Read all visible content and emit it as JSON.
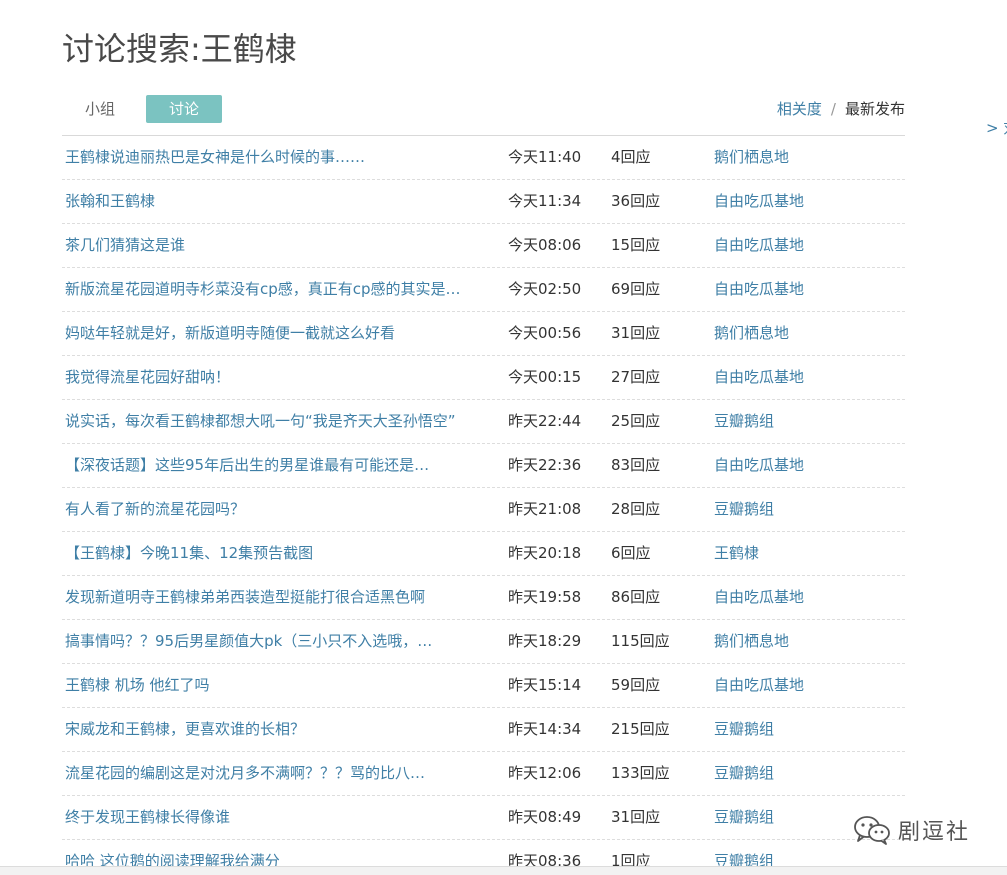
{
  "page": {
    "title": "讨论搜索:王鹤棣"
  },
  "tabs": {
    "group": "小组",
    "discussion": "讨论"
  },
  "sort": {
    "relevance": "相关度",
    "separator": "/",
    "latest": "最新发布"
  },
  "side_link": "> 刘",
  "topics": [
    {
      "title": "王鹤棣说迪丽热巴是女神是什么时候的事……",
      "time": "今天11:40",
      "replies": "4回应",
      "group": "鹅们栖息地"
    },
    {
      "title": "张翰和王鹤棣",
      "time": "今天11:34",
      "replies": "36回应",
      "group": "自由吃瓜基地"
    },
    {
      "title": "茶几们猜猜这是谁",
      "time": "今天08:06",
      "replies": "15回应",
      "group": "自由吃瓜基地"
    },
    {
      "title": "新版流星花园道明寺杉菜没有cp感，真正有cp感的其实是…",
      "time": "今天02:50",
      "replies": "69回应",
      "group": "自由吃瓜基地"
    },
    {
      "title": "妈哒年轻就是好，新版道明寺随便一截就这么好看",
      "time": "今天00:56",
      "replies": "31回应",
      "group": "鹅们栖息地"
    },
    {
      "title": "我觉得流星花园好甜呐！",
      "time": "今天00:15",
      "replies": "27回应",
      "group": "自由吃瓜基地"
    },
    {
      "title": "说实话，每次看王鹤棣都想大吼一句“我是齐天大圣孙悟空”",
      "time": "昨天22:44",
      "replies": "25回应",
      "group": "豆瓣鹅组"
    },
    {
      "title": "【深夜话题】这些95年后出生的男星谁最有可能还是…",
      "time": "昨天22:36",
      "replies": "83回应",
      "group": "自由吃瓜基地"
    },
    {
      "title": "有人看了新的流星花园吗？",
      "time": "昨天21:08",
      "replies": "28回应",
      "group": "豆瓣鹅组"
    },
    {
      "title": "【王鹤棣】今晚11集、12集预告截图",
      "time": "昨天20:18",
      "replies": "6回应",
      "group": "王鹤棣"
    },
    {
      "title": "发现新道明寺王鹤棣弟弟西装造型挺能打很合适黑色啊",
      "time": "昨天19:58",
      "replies": "86回应",
      "group": "自由吃瓜基地"
    },
    {
      "title": "搞事情吗？？95后男星颜值大pk（三小只不入选哦，…",
      "time": "昨天18:29",
      "replies": "115回应",
      "group": "鹅们栖息地"
    },
    {
      "title": "王鹤棣 机场 他红了吗",
      "time": "昨天15:14",
      "replies": "59回应",
      "group": "自由吃瓜基地"
    },
    {
      "title": "宋威龙和王鹤棣，更喜欢谁的长相？",
      "time": "昨天14:34",
      "replies": "215回应",
      "group": "豆瓣鹅组"
    },
    {
      "title": "流星花园的编剧这是对沈月多不满啊？？？骂的比八…",
      "time": "昨天12:06",
      "replies": "133回应",
      "group": "豆瓣鹅组"
    },
    {
      "title": "终于发现王鹤棣长得像谁",
      "time": "昨天08:49",
      "replies": "31回应",
      "group": "豆瓣鹅组"
    },
    {
      "title": "哈哈 这位鹅的阅读理解我给满分",
      "time": "昨天08:36",
      "replies": "1回应",
      "group": "豆瓣鹅组"
    }
  ],
  "watermark": {
    "text": "剧逗社",
    "icon": "wechat-icon"
  },
  "colors": {
    "link": "#3f7fa6",
    "active_tab": "#7bc3c1",
    "title": "#494949"
  }
}
